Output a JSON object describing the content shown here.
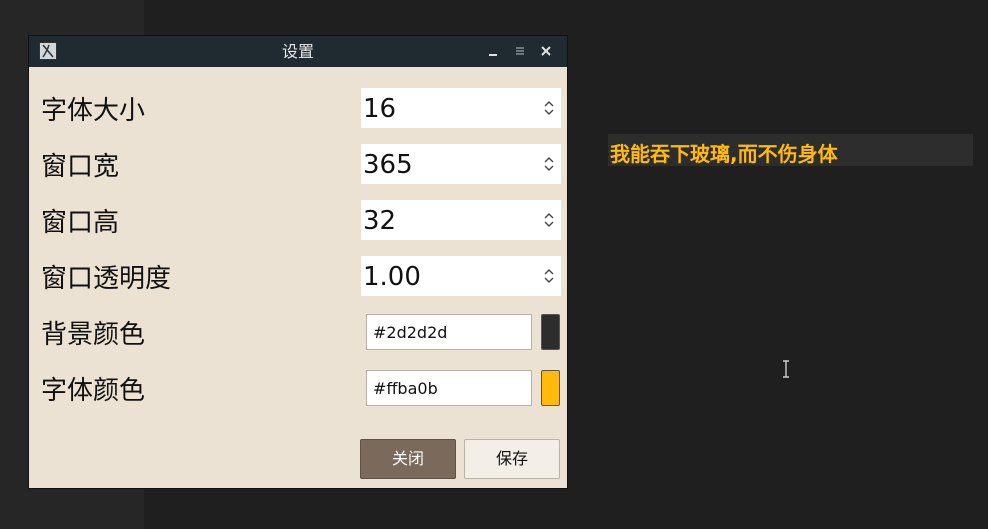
{
  "overlay": {
    "text": "我能吞下玻璃,而不伤身体",
    "background": "#2d2d2d",
    "text_color": "#ffba0b"
  },
  "window": {
    "title": "设置",
    "icons": {
      "app": "app-icon",
      "minimize": "minimize-icon",
      "maximize": "maximize-icon",
      "close": "close-icon"
    }
  },
  "settings": {
    "font_size": {
      "label": "字体大小",
      "value": "16"
    },
    "window_width": {
      "label": "窗口宽",
      "value": "365"
    },
    "window_height": {
      "label": "窗口高",
      "value": "32"
    },
    "window_opacity": {
      "label": "窗口透明度",
      "value": "1.00"
    },
    "bg_color": {
      "label": "背景颜色",
      "value": "#2d2d2d",
      "swatch": "#2d2d2d"
    },
    "font_color": {
      "label": "字体颜色",
      "value": "#ffba0b",
      "swatch": "#ffba0b"
    }
  },
  "buttons": {
    "close": "关闭",
    "save": "保存"
  }
}
